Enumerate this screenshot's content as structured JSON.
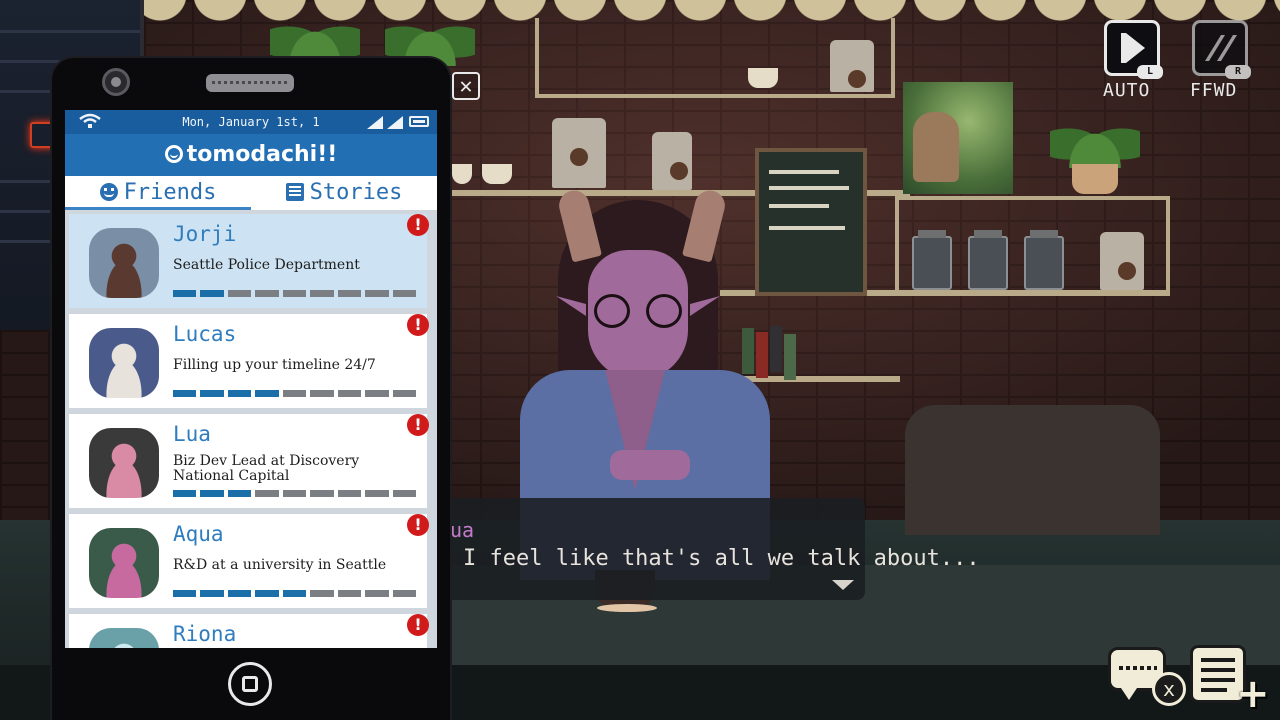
{
  "controls": {
    "auto_label": "AUTO",
    "auto_key": "L",
    "ffwd_label": "FFWD",
    "ffwd_key": "R"
  },
  "dialog": {
    "speaker": "ua",
    "text": "I feel like that's all we talk about..."
  },
  "phone": {
    "status": {
      "date": "Mon, January 1st, 1"
    },
    "app_title": "tomodachi!!",
    "tabs": [
      {
        "label": "Friends",
        "icon": "smiley-face-icon",
        "active": true
      },
      {
        "label": "Stories",
        "icon": "book-icon",
        "active": false
      }
    ],
    "friends": [
      {
        "name": "Jorji",
        "description": "Seattle Police Department",
        "progress": 2,
        "segments": 9,
        "alert": "!",
        "selected": true,
        "avatar_colors": [
          "#7a8fa6",
          "#5a3a30"
        ]
      },
      {
        "name": "Lucas",
        "description": "Filling up your timeline 24/7",
        "progress": 4,
        "segments": 9,
        "alert": "!",
        "selected": false,
        "avatar_colors": [
          "#4a5a8a",
          "#e8e2dc"
        ]
      },
      {
        "name": "Lua",
        "description": "Biz Dev Lead at Discovery National Capital",
        "progress": 3,
        "segments": 9,
        "alert": "!",
        "selected": false,
        "avatar_colors": [
          "#3a3a3a",
          "#d98aa5"
        ]
      },
      {
        "name": "Aqua",
        "description": "R&D at a university in Seattle",
        "progress": 5,
        "segments": 9,
        "alert": "!",
        "selected": false,
        "avatar_colors": [
          "#3a5a4a",
          "#c76aa0"
        ]
      },
      {
        "name": "Riona",
        "description": "",
        "progress": 0,
        "segments": 9,
        "alert": "!",
        "selected": false,
        "avatar_colors": [
          "#6aa0a8",
          "#cce8ee"
        ]
      }
    ]
  },
  "colors": {
    "app_blue": "#226fb4",
    "status_blue": "#1a5d9e",
    "progress_on": "#1a6fa8",
    "progress_off": "#7b7f84",
    "alert_red": "#d11b1b",
    "speaker_color": "#c57ac9"
  }
}
